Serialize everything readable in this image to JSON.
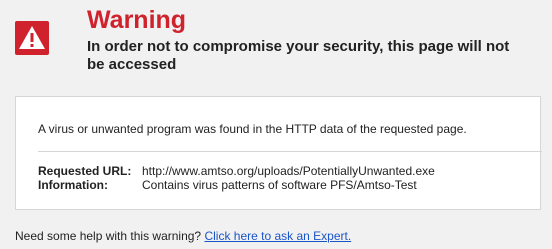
{
  "header": {
    "icon": "warning-triangle-icon",
    "title": "Warning",
    "subtitle": "In order not to compromise your security, this page will not be accessed"
  },
  "panel": {
    "message": "A virus or unwanted program was found in the HTTP data of the requested page.",
    "details": [
      {
        "label": "Requested URL:",
        "value": "http://www.amtso.org/uploads/PotentiallyUnwanted.exe"
      },
      {
        "label": "Information:",
        "value": "Contains virus patterns of software PFS/Amtso-Test"
      }
    ]
  },
  "footer": {
    "help_text": "Need some help with this warning?",
    "link_text": "Click here to ask an Expert."
  },
  "colors": {
    "accent": "#d0222c",
    "link": "#1a55c8",
    "background": "#f1f1f1"
  }
}
